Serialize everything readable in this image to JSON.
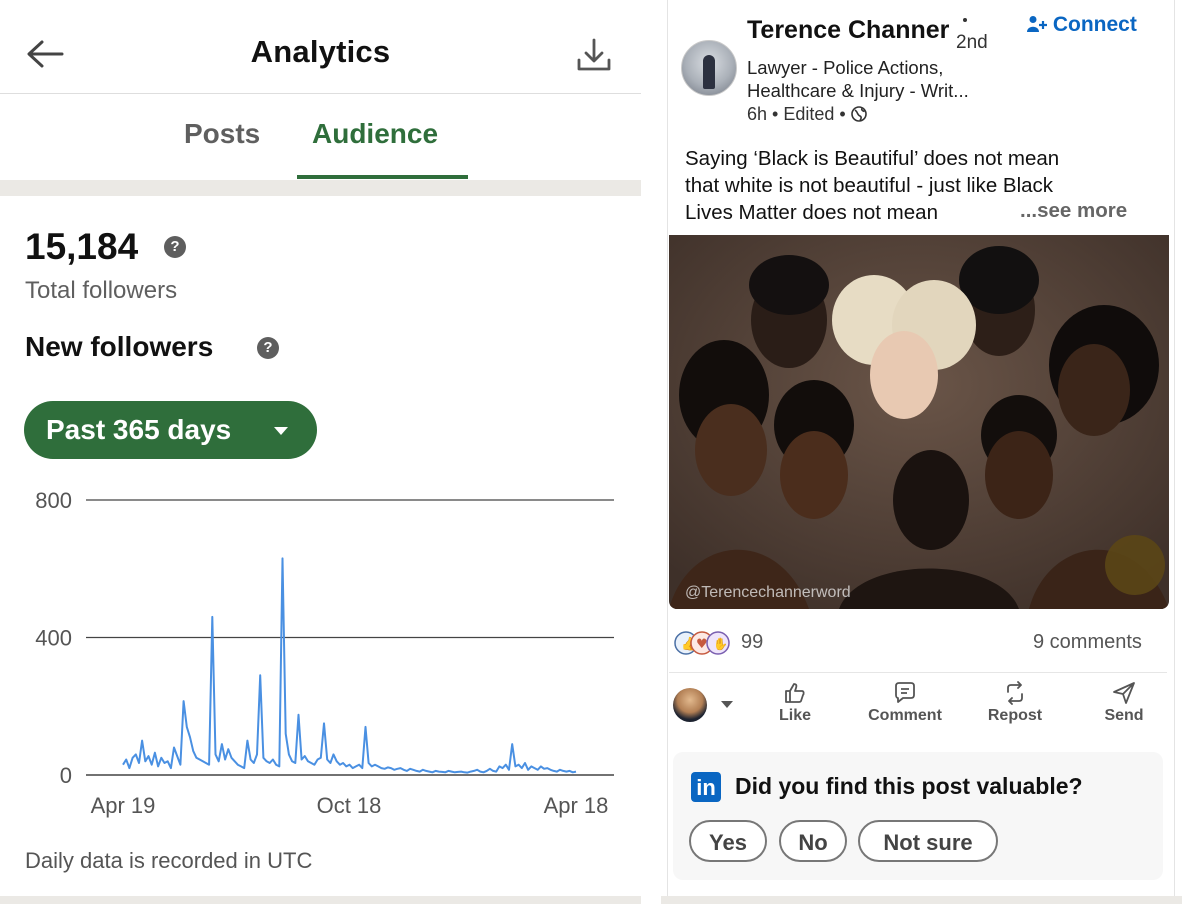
{
  "analytics": {
    "header": {
      "title": "Analytics",
      "back_icon": "arrow-left-icon",
      "download_icon": "download-icon"
    },
    "tabs": [
      {
        "label": "Posts",
        "active": false
      },
      {
        "label": "Audience",
        "active": true
      }
    ],
    "total_followers": {
      "value": "15,184",
      "label": "Total followers"
    },
    "new_followers": {
      "label": "New followers",
      "range_label": "Past 365 days"
    },
    "footnote": "Daily data is recorded in UTC",
    "colors": {
      "accent": "#2f6e3b",
      "line": "#4a90e2"
    }
  },
  "chart_data": {
    "type": "line",
    "title": "",
    "xlabel": "",
    "ylabel": "",
    "ylim": [
      0,
      800
    ],
    "yticks": [
      "0",
      "400",
      "800"
    ],
    "xticks": [
      "Apr 19",
      "Oct 18",
      "Apr 18"
    ],
    "grid": true,
    "series": [
      {
        "values": [
          30,
          45,
          20,
          50,
          60,
          35,
          100,
          40,
          55,
          30,
          65,
          25,
          50,
          35,
          40,
          20,
          80,
          55,
          30,
          215,
          140,
          110,
          70,
          50,
          45,
          40,
          35,
          30,
          460,
          60,
          40,
          90,
          45,
          75,
          50,
          40,
          30,
          25,
          20,
          100,
          45,
          35,
          60,
          290,
          50,
          40,
          35,
          45,
          30,
          25,
          630,
          120,
          60,
          40,
          35,
          175,
          45,
          55,
          40,
          35,
          30,
          45,
          50,
          150,
          45,
          35,
          60,
          40,
          30,
          35,
          25,
          30,
          20,
          25,
          30,
          20,
          140,
          35,
          25,
          30,
          25,
          20,
          18,
          22,
          20,
          15,
          18,
          20,
          15,
          12,
          18,
          15,
          12,
          10,
          15,
          12,
          10,
          8,
          12,
          10,
          9,
          8,
          12,
          10,
          8,
          9,
          10,
          8,
          7,
          10,
          12,
          15,
          10,
          8,
          12,
          18,
          12,
          10,
          25,
          20,
          30,
          15,
          90,
          25,
          30,
          20,
          35,
          15,
          25,
          20,
          15,
          25,
          18,
          20,
          15,
          12,
          10,
          15,
          12,
          10,
          12,
          8,
          10
        ]
      }
    ]
  },
  "post": {
    "author": {
      "name": "Terence Channer",
      "degree": "2nd",
      "headline_line1": "Lawyer - Police Actions,",
      "headline_line2": "Healthcare & Injury - Writ...",
      "meta": "6h • Edited •",
      "connect_label": "Connect"
    },
    "text_lines": [
      "Saying ‘Black is Beautiful’ does not mean",
      "that white is not beautiful - just like Black",
      "Lives Matter does not mean"
    ],
    "see_more": "...see more",
    "image_watermark": "@Terencechannerword",
    "reaction_count": "99",
    "comments_count": "9 comments",
    "actions": [
      {
        "label": "Like",
        "icon": "thumbs-up-icon"
      },
      {
        "label": "Comment",
        "icon": "comment-icon"
      },
      {
        "label": "Repost",
        "icon": "repost-icon"
      },
      {
        "label": "Send",
        "icon": "send-icon"
      }
    ],
    "survey": {
      "logo": "in",
      "question": "Did you find this post valuable?",
      "options": [
        "Yes",
        "No",
        "Not sure"
      ]
    }
  }
}
